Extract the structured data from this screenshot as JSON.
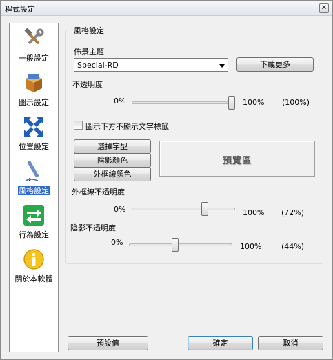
{
  "window": {
    "title": "程式設定",
    "close_glyph": "✕"
  },
  "sidebar": {
    "items": [
      {
        "label": "一般設定",
        "icon": "wrench-hammer-icon",
        "selected": false
      },
      {
        "label": "圖示設定",
        "icon": "package-box-icon",
        "selected": false
      },
      {
        "label": "位置設定",
        "icon": "move-arrows-icon",
        "selected": false
      },
      {
        "label": "風格設定",
        "icon": "pen-icon",
        "selected": true
      },
      {
        "label": "行為設定",
        "icon": "exchange-arrows-icon",
        "selected": false
      },
      {
        "label": "關於本軟體",
        "icon": "info-icon",
        "selected": false
      }
    ]
  },
  "style_group": {
    "legend": "風格設定",
    "background_theme": {
      "label": "佈景主題",
      "selected": "Special-RD",
      "download_more": "下載更多"
    },
    "opacity": {
      "label": "不透明度",
      "min": "0%",
      "max": "100%",
      "value": 100,
      "value_text": "(100%)"
    },
    "hide_text_labels": {
      "label": "圖示下方不顯示文字標籤",
      "checked": false
    },
    "buttons": {
      "choose_font": "選擇字型",
      "shadow_color": "陰影顏色",
      "outline_color": "外框線顏色"
    },
    "preview": {
      "text": "預覽區"
    },
    "outline_opacity": {
      "label": "外框線不透明度",
      "min": "0%",
      "max": "100%",
      "value": 72,
      "value_text": "(72%)"
    },
    "shadow_opacity": {
      "label": "陰影不透明度",
      "min": "0%",
      "max": "100%",
      "value": 44,
      "value_text": "(44%)"
    }
  },
  "footer": {
    "defaults": "預設值",
    "ok": "確定",
    "cancel": "取消"
  },
  "colors": {
    "selection": "#3169c6",
    "default_button_border": "#3c7fb1"
  }
}
